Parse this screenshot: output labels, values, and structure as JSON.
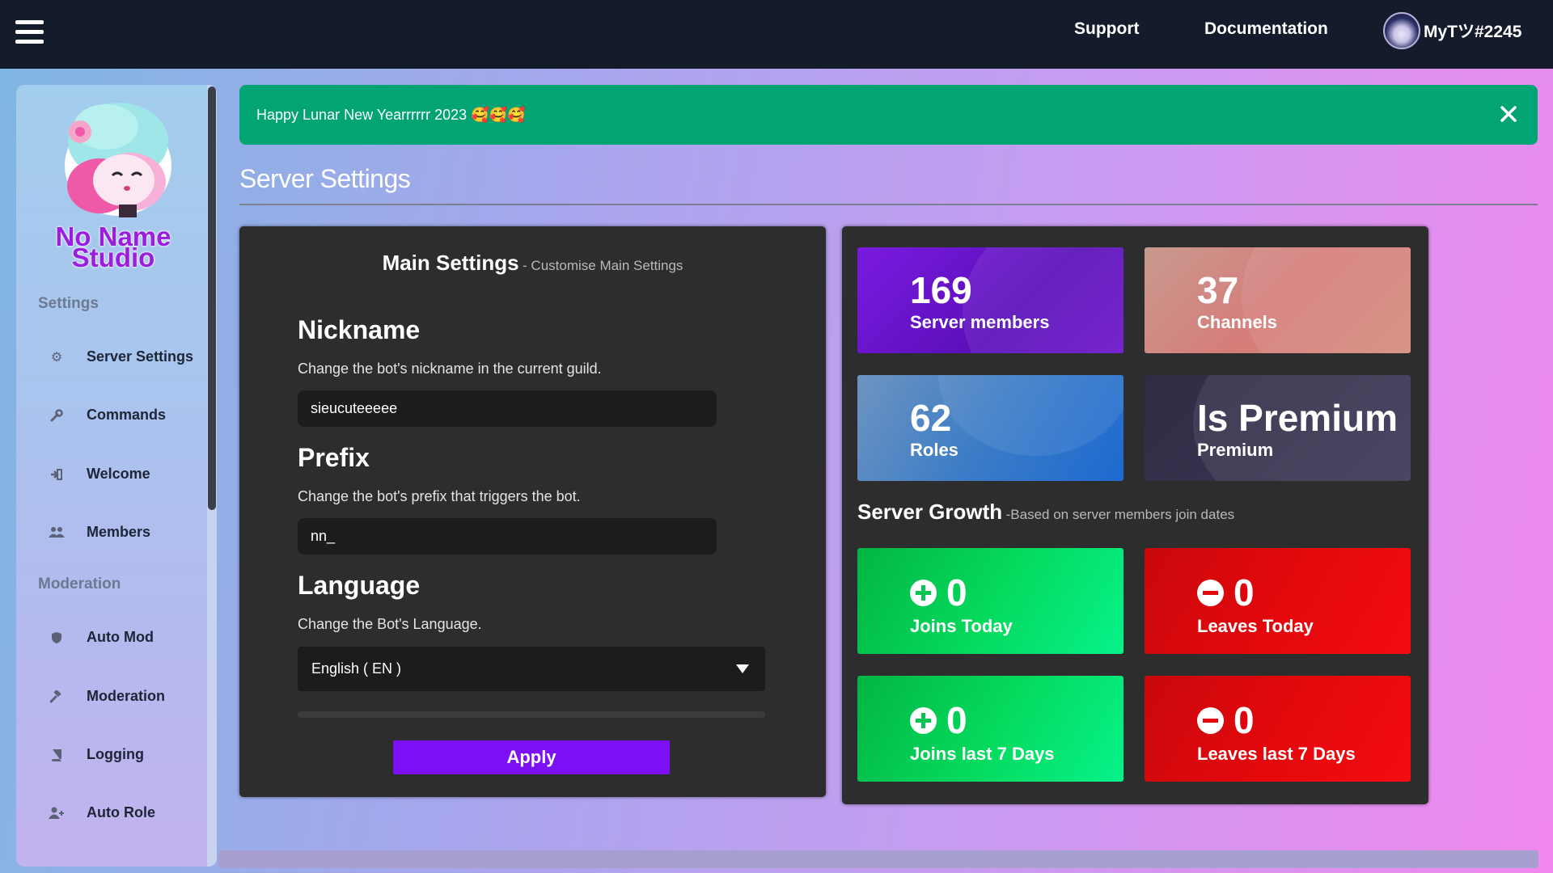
{
  "topbar": {
    "support": "Support",
    "documentation": "Documentation",
    "username": "MyTツ#2245"
  },
  "sidebar": {
    "brand_line1": "No Name",
    "brand_line2": "Studio",
    "settings_label": "Settings",
    "moderation_label": "Moderation",
    "settings_items": [
      {
        "label": "Server Settings",
        "icon": "gear-icon"
      },
      {
        "label": "Commands",
        "icon": "wrench-icon"
      },
      {
        "label": "Welcome",
        "icon": "sign-in-icon"
      },
      {
        "label": "Members",
        "icon": "users-icon"
      }
    ],
    "moderation_items": [
      {
        "label": "Auto Mod",
        "icon": "shield-icon"
      },
      {
        "label": "Moderation",
        "icon": "gavel-icon"
      },
      {
        "label": "Logging",
        "icon": "book-icon"
      },
      {
        "label": "Auto Role",
        "icon": "user-plus-icon"
      }
    ]
  },
  "banner": {
    "text": "Happy Lunar New Yearrrrrr 2023 🥰🥰🥰",
    "color": "#01a472"
  },
  "page": {
    "title": "Server Settings"
  },
  "main_settings": {
    "title": "Main Settings",
    "subtitle": "- Customise Main Settings",
    "nickname": {
      "title": "Nickname",
      "description": "Change the bot's nickname in the current guild.",
      "value": "sieucuteeeee"
    },
    "prefix": {
      "title": "Prefix",
      "description": "Change the bot's prefix that triggers the bot.",
      "value": "nn_"
    },
    "language": {
      "title": "Language",
      "description": "Change the Bot's Language.",
      "selected": "English ( EN )"
    },
    "apply_label": "Apply",
    "accent": "#7b10f5"
  },
  "stats": {
    "members": {
      "value": "169",
      "label": "Server members"
    },
    "channels": {
      "value": "37",
      "label": "Channels"
    },
    "roles": {
      "value": "62",
      "label": "Roles"
    },
    "premium": {
      "value": "Is Premium",
      "label": "Premium"
    }
  },
  "growth": {
    "title": "Server Growth",
    "subtitle": "-Based on server members join dates",
    "joins_today": {
      "value": "0",
      "label": "Joins Today"
    },
    "leaves_today": {
      "value": "0",
      "label": "Leaves Today"
    },
    "joins_7d": {
      "value": "0",
      "label": "Joins last 7 Days"
    },
    "leaves_7d": {
      "value": "0",
      "label": "Leaves last 7 Days"
    },
    "join_color": "#05d95c",
    "leave_color": "#e2080c"
  }
}
